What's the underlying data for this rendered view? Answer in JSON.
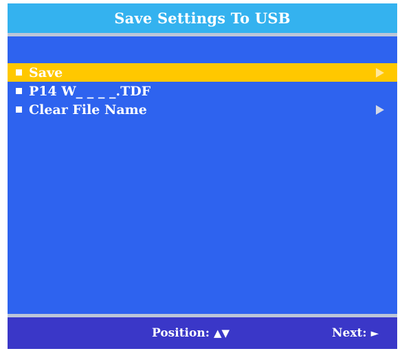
{
  "window": {
    "title": "Save Settings To USB"
  },
  "menu": {
    "items": [
      {
        "label": "Save",
        "selected": true,
        "has_arrow": true
      },
      {
        "label": "P14 W_ _ _ _.TDF",
        "selected": false,
        "has_arrow": false
      },
      {
        "label": "Clear File Name",
        "selected": false,
        "has_arrow": true
      }
    ]
  },
  "footer": {
    "position_label": "Position:",
    "position_glyph": "▲▼",
    "next_label": "Next:",
    "next_glyph": "►"
  },
  "colors": {
    "background": "#2e63ef",
    "title_bar": "#34b2ef",
    "highlight": "#ffc800",
    "footer": "#3a37c8",
    "separator": "#bcc6d8"
  },
  "icons": {
    "bullet": "square-bullet-icon",
    "arrow": "triangle-right-icon"
  }
}
